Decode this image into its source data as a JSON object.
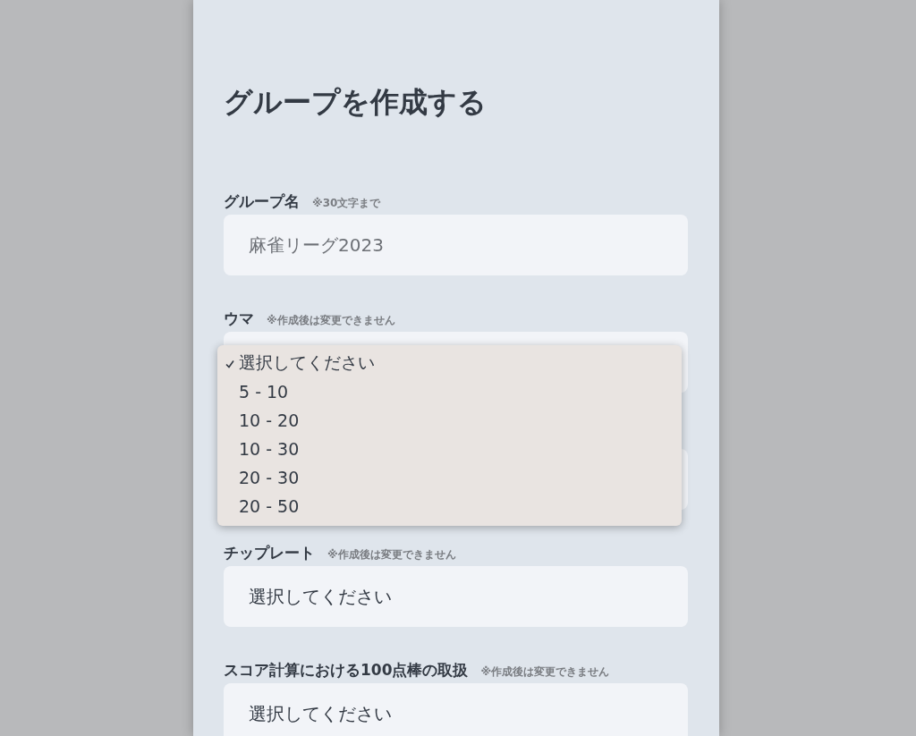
{
  "page": {
    "title": "グループを作成する"
  },
  "fields": [
    {
      "kind": "text",
      "label": "グループ名",
      "note": "※30文字まで",
      "placeholder": "麻雀リーグ2023"
    },
    {
      "kind": "select",
      "label": "ウマ",
      "note": "※作成後は変更できません",
      "expanded": true,
      "options": [
        {
          "label": "選択してください",
          "selected": true
        },
        {
          "label": "5 - 10",
          "selected": false
        },
        {
          "label": "10 - 20",
          "selected": false
        },
        {
          "label": "10 - 30",
          "selected": false
        },
        {
          "label": "20 - 30",
          "selected": false
        },
        {
          "label": "20 - 50",
          "selected": false
        }
      ]
    },
    {
      "kind": "covered"
    },
    {
      "kind": "select",
      "label": "チップレート",
      "note": "※作成後は変更できません",
      "expanded": false,
      "value": "選択してください"
    },
    {
      "kind": "select",
      "label": "スコア計算における100点棒の取扱",
      "note": "※作成後は変更できません",
      "expanded": false,
      "value": "選択してください"
    }
  ]
}
